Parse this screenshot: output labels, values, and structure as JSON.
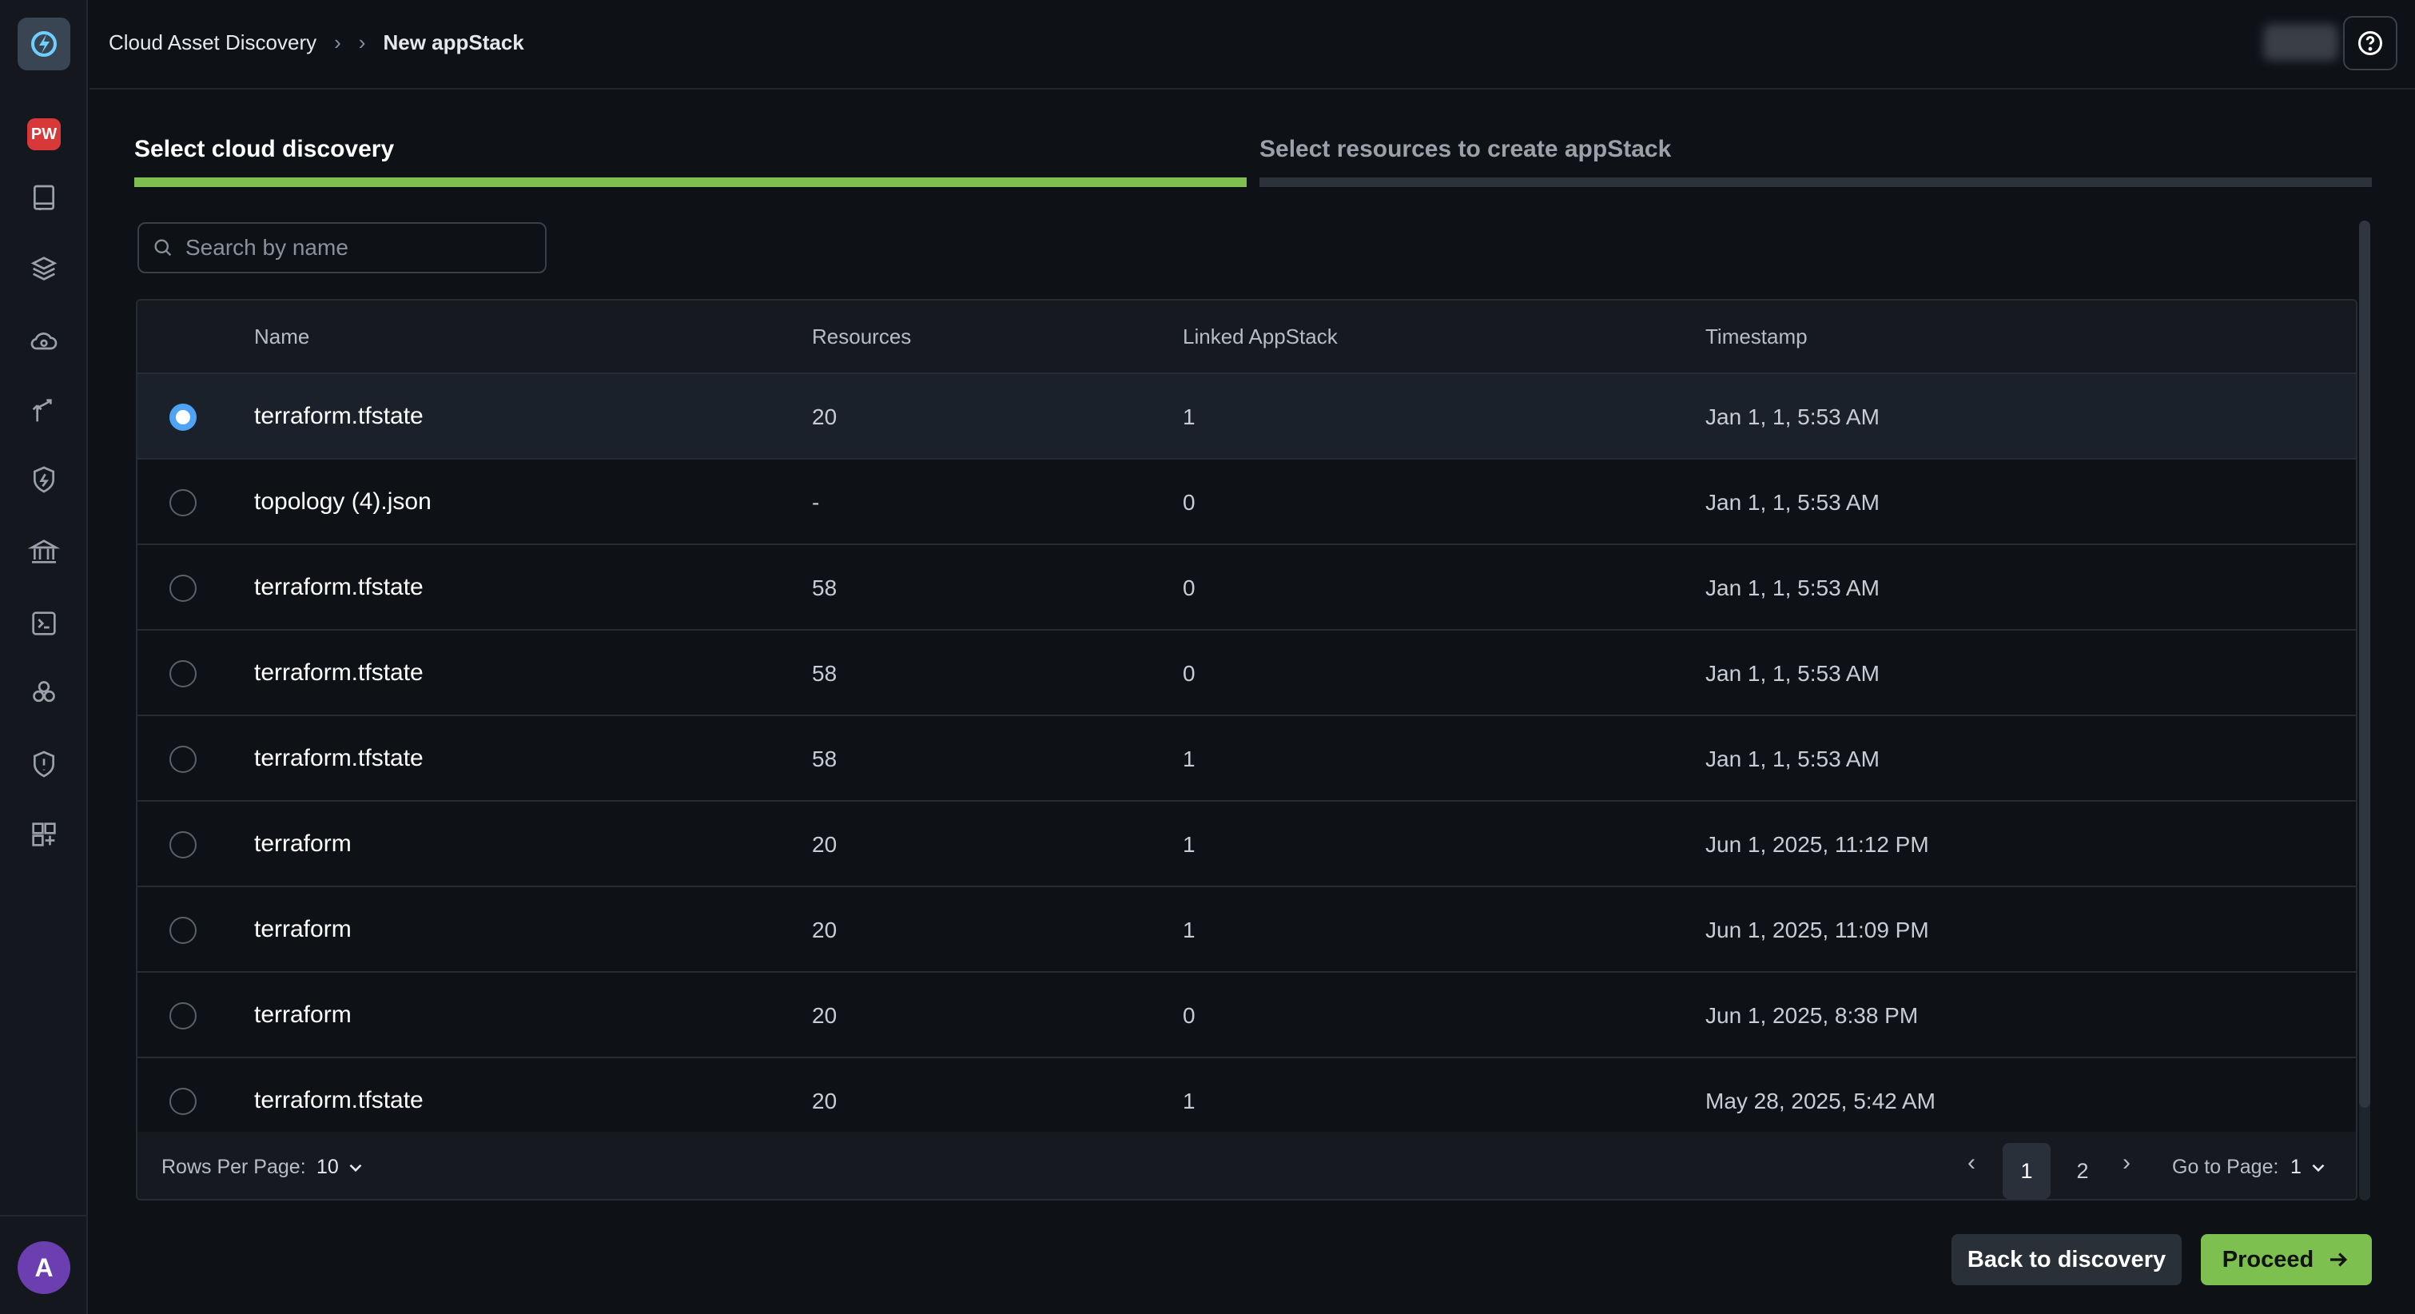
{
  "header": {
    "breadcrumb": [
      "Cloud Asset Discovery",
      "New appStack"
    ]
  },
  "sidebar": {
    "badge": "PW",
    "avatar": "A",
    "icons": [
      "book-icon",
      "layers-icon",
      "cloud-search-icon",
      "branch-icon",
      "shield-bolt-icon",
      "bank-icon",
      "terminal-icon",
      "cubes-icon",
      "shield-alert-icon",
      "grid-plus-icon"
    ]
  },
  "steps": {
    "step1": "Select cloud discovery",
    "step2": "Select resources to create appStack"
  },
  "search": {
    "placeholder": "Search by name"
  },
  "table": {
    "columns": [
      "Name",
      "Resources",
      "Linked AppStack",
      "Timestamp"
    ],
    "rows": [
      {
        "name": "terraform.tfstate",
        "resources": "20",
        "linked": "1",
        "timestamp": "Jan 1, 1, 5:53 AM",
        "selected": true
      },
      {
        "name": "topology (4).json",
        "resources": "-",
        "linked": "0",
        "timestamp": "Jan 1, 1, 5:53 AM",
        "selected": false
      },
      {
        "name": "terraform.tfstate",
        "resources": "58",
        "linked": "0",
        "timestamp": "Jan 1, 1, 5:53 AM",
        "selected": false
      },
      {
        "name": "terraform.tfstate",
        "resources": "58",
        "linked": "0",
        "timestamp": "Jan 1, 1, 5:53 AM",
        "selected": false
      },
      {
        "name": "terraform.tfstate",
        "resources": "58",
        "linked": "1",
        "timestamp": "Jan 1, 1, 5:53 AM",
        "selected": false
      },
      {
        "name": "terraform",
        "resources": "20",
        "linked": "1",
        "timestamp": "Jun 1, 2025, 11:12 PM",
        "selected": false
      },
      {
        "name": "terraform",
        "resources": "20",
        "linked": "1",
        "timestamp": "Jun 1, 2025, 11:09 PM",
        "selected": false
      },
      {
        "name": "terraform",
        "resources": "20",
        "linked": "0",
        "timestamp": "Jun 1, 2025, 8:38 PM",
        "selected": false
      },
      {
        "name": "terraform.tfstate",
        "resources": "20",
        "linked": "1",
        "timestamp": "May 28, 2025, 5:42 AM",
        "selected": false
      }
    ]
  },
  "pagination": {
    "rows_per_page_label": "Rows Per Page:",
    "rows_per_page_value": "10",
    "pages": [
      "1",
      "2"
    ],
    "current_page": "1",
    "goto_label": "Go to Page:",
    "goto_value": "1"
  },
  "actions": {
    "back_label": "Back to discovery",
    "proceed_label": "Proceed"
  },
  "colors": {
    "accent_green": "#7dc04f",
    "radio_blue": "#4fa3f5",
    "badge_red": "#d8383a",
    "avatar_purple": "#6b3fb0"
  }
}
